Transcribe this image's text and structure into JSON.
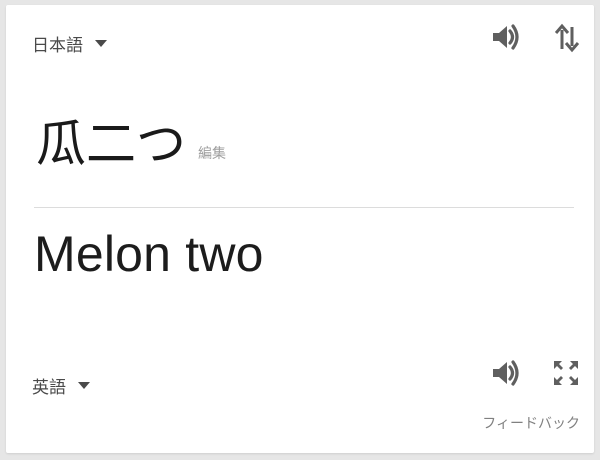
{
  "source": {
    "language": "日本語",
    "text": "瓜二つ",
    "edit_label": "編集"
  },
  "target": {
    "language": "英語",
    "text": "Melon two"
  },
  "footer": {
    "feedback_label": "フィードバック"
  },
  "icons": {
    "source_dropdown": "caret-down-icon",
    "source_speaker": "speaker-icon",
    "swap": "swap-languages-icon",
    "target_dropdown": "caret-down-icon",
    "target_speaker": "speaker-icon",
    "expand": "fullscreen-icon"
  },
  "colors": {
    "background": "#e6e6e6",
    "card": "#ffffff",
    "text": "#1c1c1c",
    "muted": "#9e9e9e",
    "icon": "#5f5f5f"
  }
}
